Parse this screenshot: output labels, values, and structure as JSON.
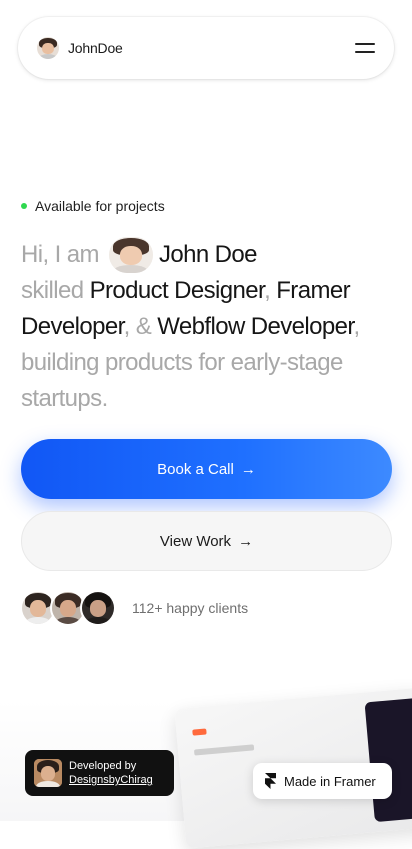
{
  "nav": {
    "brand": "JohnDoe",
    "menu_icon": "hamburger-icon"
  },
  "status": {
    "text": "Available for projects",
    "dot_color": "#2fd84f"
  },
  "hero": {
    "greeting": "Hi, I am",
    "name": "John Doe",
    "skilled": "skilled",
    "role1": "Product Designer",
    "sep1": ",",
    "role2": "Framer",
    "role2b": "Developer",
    "sep2": ", &",
    "role3": "Webflow Developer",
    "sep3": ",",
    "tagline1": "building products for early-stage",
    "tagline2": "startups."
  },
  "buttons": {
    "primary": "Book a Call",
    "primary_arrow": "→",
    "secondary": "View Work",
    "secondary_arrow": "→",
    "accent_color": "#1f6bff"
  },
  "clients": {
    "text": "112+ happy clients"
  },
  "badges": {
    "developed_by": "Developed by",
    "developer": "DesignsbyChirag",
    "framer": "Made in Framer"
  }
}
